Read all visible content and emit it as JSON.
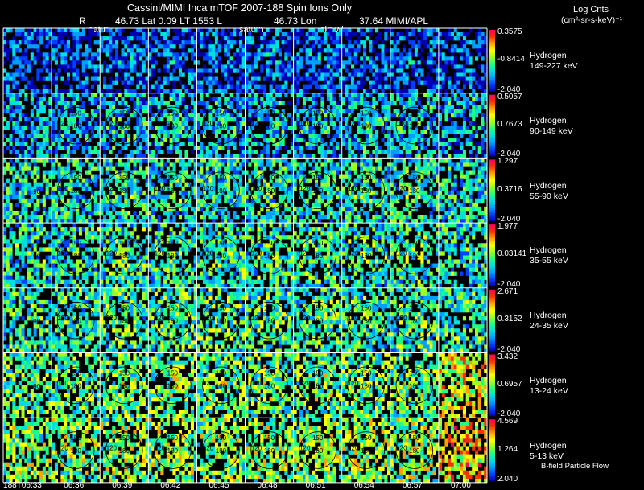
{
  "header": {
    "title": "Cassini/MIMI Inca mTOF  2007-188   Spin    Ions Only",
    "info_r": "R",
    "info_main": "46.73 Lat 0.09 LT 1553 L",
    "info_lon": "46.73 Lon",
    "info_right": "37.64   MIMI/APL",
    "label_satur_left": "satur",
    "label_satur_mid": "saturn",
    "label_skr": "skr-wl",
    "legend_title": "Log Cnts",
    "legend_units": "(cm²-sr-s-keV)⁻¹"
  },
  "footer": {
    "b_field_label": "B-field Particle Flow"
  },
  "chart_data": {
    "type": "heatmap",
    "x_tick_labels": [
      "188T06:33",
      "06:36",
      "06:39",
      "06:42",
      "06:45",
      "06:48",
      "06:51",
      "06:54",
      "06:57",
      "07:00"
    ],
    "panel_labels": [
      "300",
      "120",
      "180",
      "150",
      "90"
    ],
    "rows": [
      {
        "species": "Hydrogen",
        "energy": "149-227 keV",
        "cb_max": "0.3575",
        "cb_mid": "-0.8414",
        "cb_min": "-2.040",
        "level": 0.15
      },
      {
        "species": "Hydrogen",
        "energy": "90-149 keV",
        "cb_max": "0.5057",
        "cb_mid": "0.7673",
        "cb_min": "-2.040",
        "level": 0.28
      },
      {
        "species": "Hydrogen",
        "energy": "55-90 keV",
        "cb_max": "1.297",
        "cb_mid": "0.3716",
        "cb_min": "-2.040",
        "level": 0.36
      },
      {
        "species": "Hydrogen",
        "energy": "35-55 keV",
        "cb_max": "1.977",
        "cb_mid": "0.03141",
        "cb_min": "-2.040",
        "level": 0.38
      },
      {
        "species": "Hydrogen",
        "energy": "24-35 keV",
        "cb_max": "2.671",
        "cb_mid": "0.3152",
        "cb_min": "-2.040",
        "level": 0.4
      },
      {
        "species": "Hydrogen",
        "energy": "13-24 keV",
        "cb_max": "3.432",
        "cb_mid": "0.6957",
        "cb_min": "-2.040",
        "level": 0.45
      },
      {
        "species": "Hydrogen",
        "energy": "5-13 keV",
        "cb_max": "4.569",
        "cb_mid": "1.264",
        "cb_min": "2.040",
        "level": 0.5
      }
    ],
    "colorscale": [
      "#0000b0",
      "#0040ff",
      "#00a0ff",
      "#00e0e0",
      "#20ff80",
      "#a0ff20",
      "#ffff00",
      "#ffa000",
      "#ff3000",
      "#ff0060"
    ]
  }
}
